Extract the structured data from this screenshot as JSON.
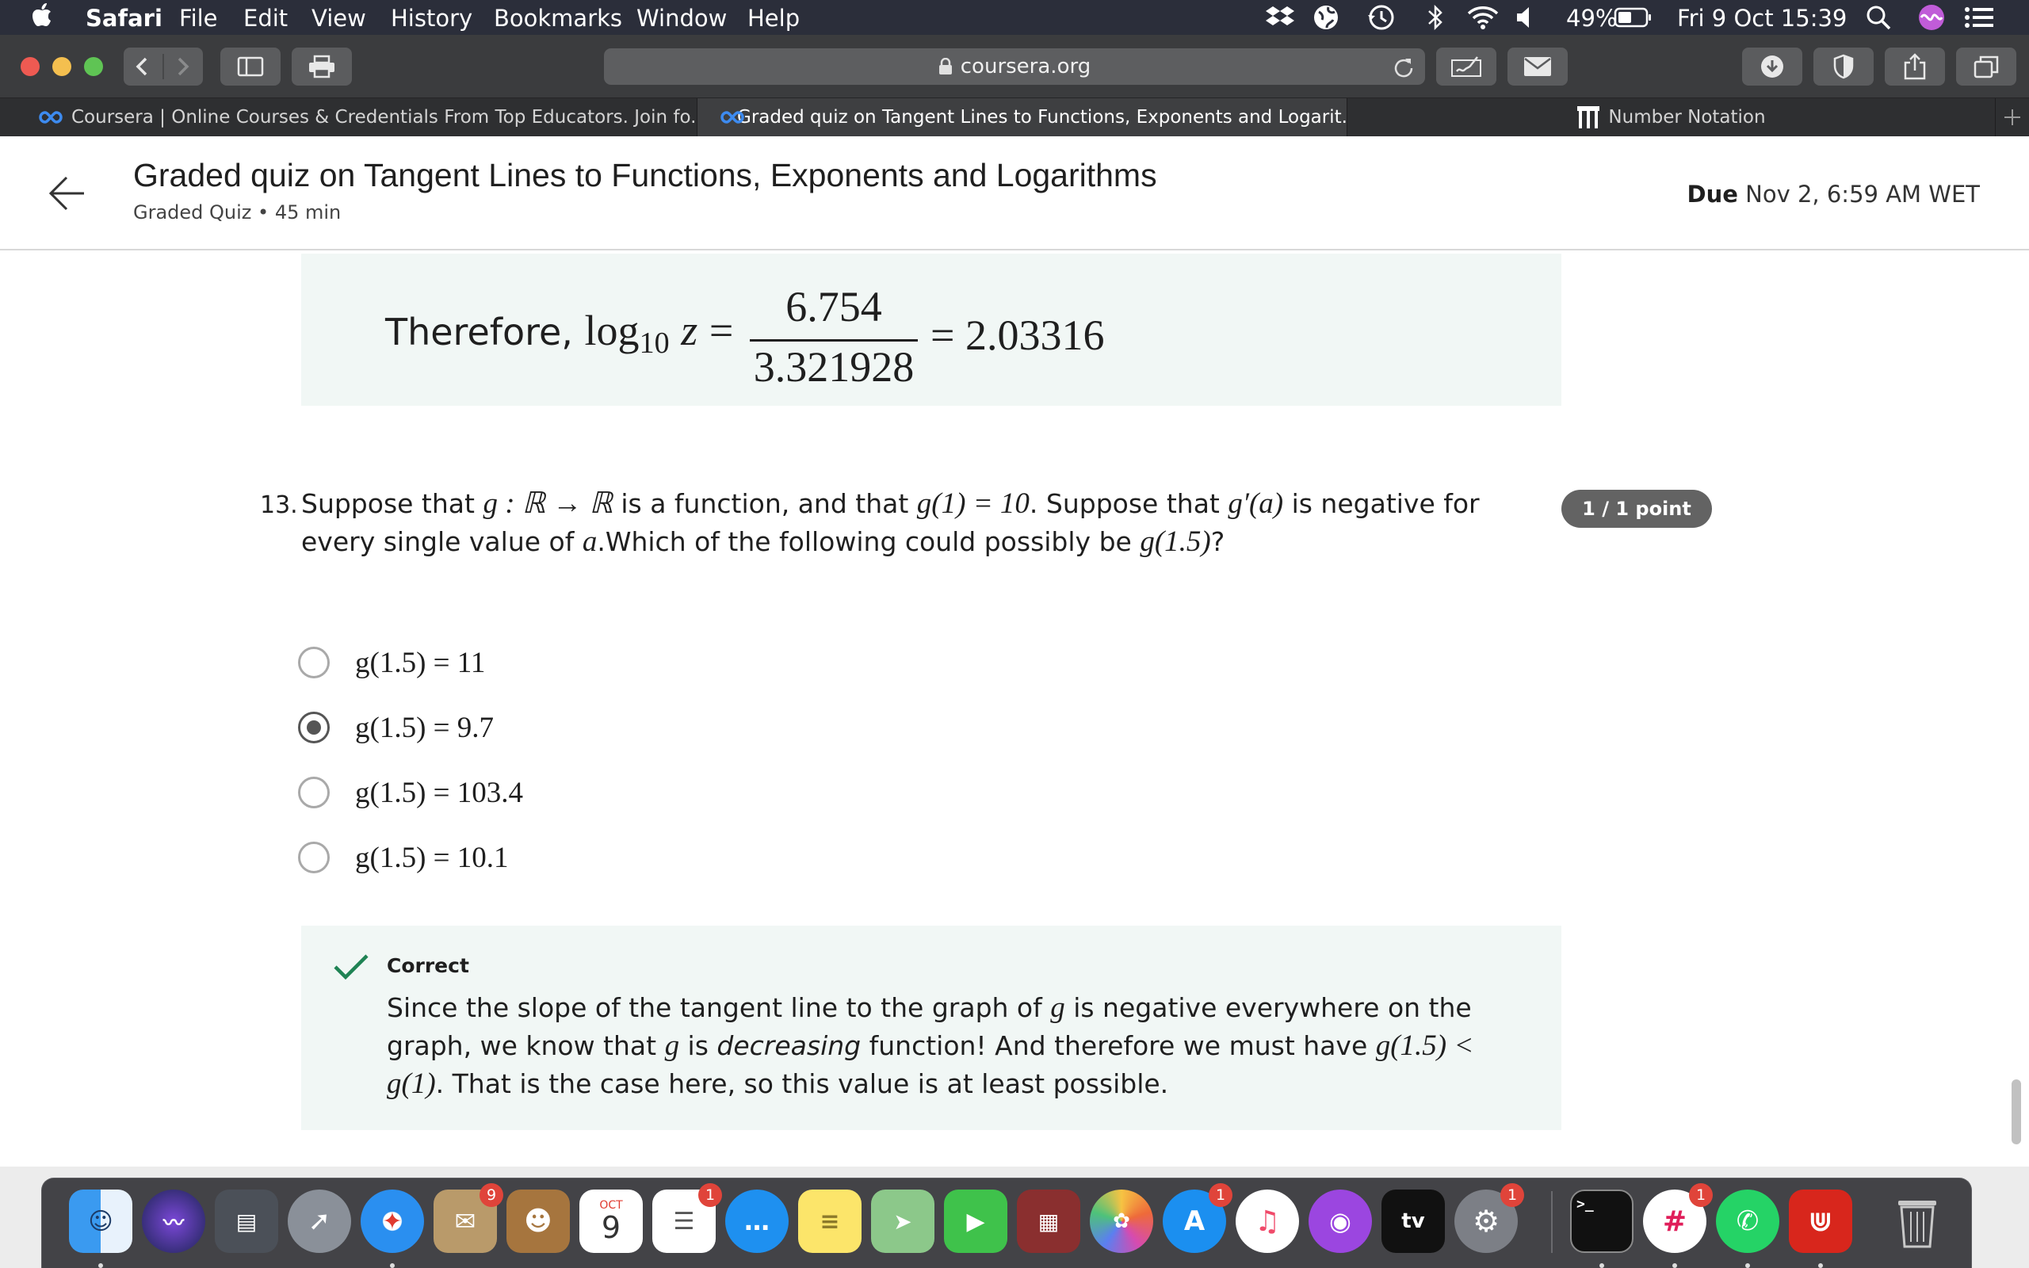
{
  "menubar": {
    "app": "Safari",
    "items": [
      "File",
      "Edit",
      "View",
      "History",
      "Bookmarks",
      "Window",
      "Help"
    ],
    "battery": "49%",
    "datetime": "Fri 9 Oct  15:39"
  },
  "toolbar": {
    "url": "coursera.org"
  },
  "tabs": [
    {
      "label": "Coursera | Online Courses & Credentials From Top Educators. Join fo..."
    },
    {
      "label": "Graded quiz on Tangent Lines to Functions, Exponents and Logarit..."
    },
    {
      "label": "Number Notation"
    }
  ],
  "header": {
    "title": "Graded quiz on Tangent Lines to Functions, Exponents and Logarithms",
    "subtitle": "Graded Quiz • 45 min",
    "due_label": "Due",
    "due_value": " Nov 2, 6:59 AM WET"
  },
  "prev_explanation": {
    "prefix": "Therefore,",
    "log": "log",
    "base": "10",
    "var": "z",
    "eq": "=",
    "numerator": "6.754",
    "denominator": "3.321928",
    "result": "= 2.03316"
  },
  "question": {
    "number": "13.",
    "text_1": "Suppose that ",
    "math_1": "g : ℝ → ℝ",
    "text_2": " is a function, and that ",
    "math_2": "g(1) = 10",
    "text_3": ". Suppose that ",
    "math_3": "g′(a)",
    "text_4": " is negative for every single value of ",
    "math_4": "a",
    "text_5": ".Which of the following could possibly be ",
    "math_5": "g(1.5)",
    "text_6": "?",
    "points": "1 / 1 point",
    "options": [
      {
        "label": "g(1.5) = 11",
        "selected": false
      },
      {
        "label": "g(1.5) = 9.7",
        "selected": true
      },
      {
        "label": "g(1.5) = 103.4",
        "selected": false
      },
      {
        "label": "g(1.5) = 10.1",
        "selected": false
      }
    ]
  },
  "feedback": {
    "title": "Correct",
    "t1": "Since the slope of the tangent line to the graph of ",
    "m1": "g",
    "t2": " is negative everywhere on the graph, we know that ",
    "m2": "g",
    "t3": " is ",
    "em": "decreasing",
    "t4": " function! And therefore we must have ",
    "m3": "g(1.5) < g(1)",
    "t5": ". That is the case here, so this value is at least possible."
  },
  "dock": {
    "badges": {
      "mail": "9",
      "reminders": "1",
      "appstore": "1",
      "prefs": "1",
      "slack": "1"
    },
    "calendar_month": "OCT",
    "calendar_day": "9",
    "tv_label": "tv"
  },
  "colors": {
    "menubar": "#2b2e3a",
    "accent_green": "#1f8354",
    "badge_red": "#e0443a",
    "explanation_bg": "#f1f7f5"
  }
}
